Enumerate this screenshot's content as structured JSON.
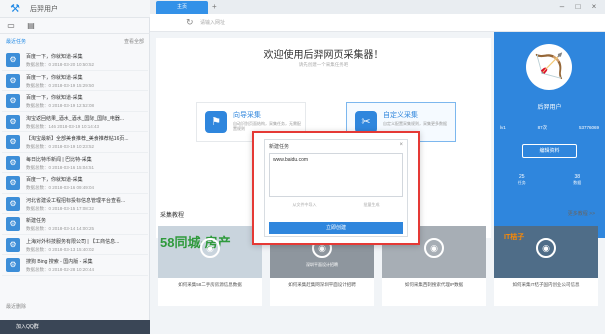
{
  "window": {
    "user": "后羿用户",
    "logo_icon": "archer-logo-icon"
  },
  "sidebar": {
    "recent_title": "最近任务",
    "recent_all": "查看全部",
    "recycle": "最近删除",
    "bottom_label": "加入QQ群",
    "items": [
      {
        "name": "百度一下，你就知道-采集",
        "meta": "数据总数：0    2018-03-20 10:50:52"
      },
      {
        "name": "百度一下，你就知道-采集",
        "meta": "数据总数：0    2018-03-19 15:29:50"
      },
      {
        "name": "百度一下，你就知道-采集",
        "meta": "数据总数：0    2018-03-19 12:52:08"
      },
      {
        "name": "淘宝返回结果_酒水_酒水_国际_国际_电器...",
        "meta": "数据总数：146    2018-03-19 10:14:43"
      },
      {
        "name": "【淘宝最新】全部美食推荐_美食推荐帖16页...",
        "meta": "数据总数：0    2018-03-19 10:23:52"
      },
      {
        "name": "每日比特币新闻 | 巴比特-采集",
        "meta": "数据总数：0    2018-03-16 15:04:51"
      },
      {
        "name": "百度一下，你就知道-采集",
        "meta": "数据总数：0    2018-03-16 09:49:04"
      },
      {
        "name": "河北省建设工程招标投标信息管理平台查看...",
        "meta": "数据总数：0    2018-03-15 17:08:32"
      },
      {
        "name": "新建任务",
        "meta": "数据总数：0    2018-03-14 14:00:25"
      },
      {
        "name": "上海对外科技服务有限公司 | 【工商信息...",
        "meta": "数据总数：0    2018-03-13 15:40:02"
      },
      {
        "name": "搜狗 Bing 搜索 - 国内版 - 采集",
        "meta": "数据总数：0    2018-02-28 10:20:44"
      }
    ]
  },
  "tabs": {
    "home": "主页",
    "add": "+"
  },
  "urlbar": {
    "placeholder": "请输入网址"
  },
  "welcome": {
    "title": "欢迎使用后羿网页采集器！",
    "subtitle": "请先创建一个采集任务吧",
    "smart_label": "向导采集",
    "smart_desc": "自动识别页面结构，采集任务，无需配置规则",
    "custom_label": "自定义采集",
    "custom_desc": "自定义配置采集规则，采集更多数据"
  },
  "profile": {
    "name": "后羿用户",
    "stat1": "lv1",
    "stat2": "87次",
    "stat3": "53776069",
    "edit": "编辑资料",
    "bottom1_num": "25",
    "bottom1_lbl": "任务",
    "bottom2_num": "38",
    "bottom2_lbl": "数据"
  },
  "tutorial": {
    "title": "采集教程",
    "more": "更多教程 >>",
    "items": [
      {
        "brand": "58同城·房产",
        "caption": "",
        "text": "如何采集58二手房房源信息数据"
      },
      {
        "brand": "",
        "caption": "深圳平面设计招聘",
        "text": "如何采集赶集网深圳平面设计招聘"
      },
      {
        "brand": "",
        "caption": "",
        "text": "如何采集西刺搜索代理IP数据"
      },
      {
        "brand": "IT桔子",
        "caption": "",
        "text": "如何采集IT桔子国内创业公司信息"
      }
    ]
  },
  "modal": {
    "title": "新建任务",
    "close": "×",
    "url": "www.baidu.com",
    "opt1": "从文件中导入",
    "opt2": "批量生成",
    "ok": "立即创建"
  }
}
